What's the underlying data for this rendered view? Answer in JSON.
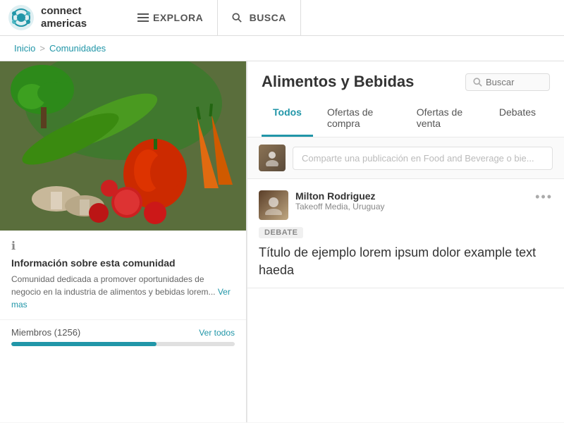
{
  "header": {
    "logo_text_line1": "connect",
    "logo_text_line2": "americas",
    "nav": [
      {
        "id": "explora",
        "label": "EXPLORA",
        "icon": "menu"
      },
      {
        "id": "busca",
        "label": "BUSCA",
        "icon": "search"
      }
    ]
  },
  "breadcrumb": {
    "home": "Inicio",
    "separator": ">",
    "current": "Comunidades"
  },
  "sidebar": {
    "community_title": "Información sobre esta comunidad",
    "community_desc": "Comunidad dedicada a promover oportunidades de negocio en la industria de alimentos y bebidas lorem...",
    "community_desc_link": "Ver mas",
    "members_label": "Miembros (1256)",
    "members_link": "Ver todos",
    "members_progress": 65
  },
  "content": {
    "title": "Alimentos y Bebidas",
    "search_placeholder": "Buscar",
    "tabs": [
      {
        "id": "todos",
        "label": "Todos",
        "active": true
      },
      {
        "id": "ofertas-compra",
        "label": "Ofertas de compra",
        "active": false
      },
      {
        "id": "ofertas-venta",
        "label": "Ofertas de venta",
        "active": false
      },
      {
        "id": "debates",
        "label": "Debates",
        "active": false
      }
    ],
    "post_placeholder": "Comparte una publicación en Food and Beverage o bie...",
    "post": {
      "author_name": "Milton Rodriguez",
      "author_meta": "Takeoff Media, Uruguay",
      "badge": "DEBATE",
      "title": "Título de ejemplo lorem ipsum dolor example text haeda"
    }
  }
}
